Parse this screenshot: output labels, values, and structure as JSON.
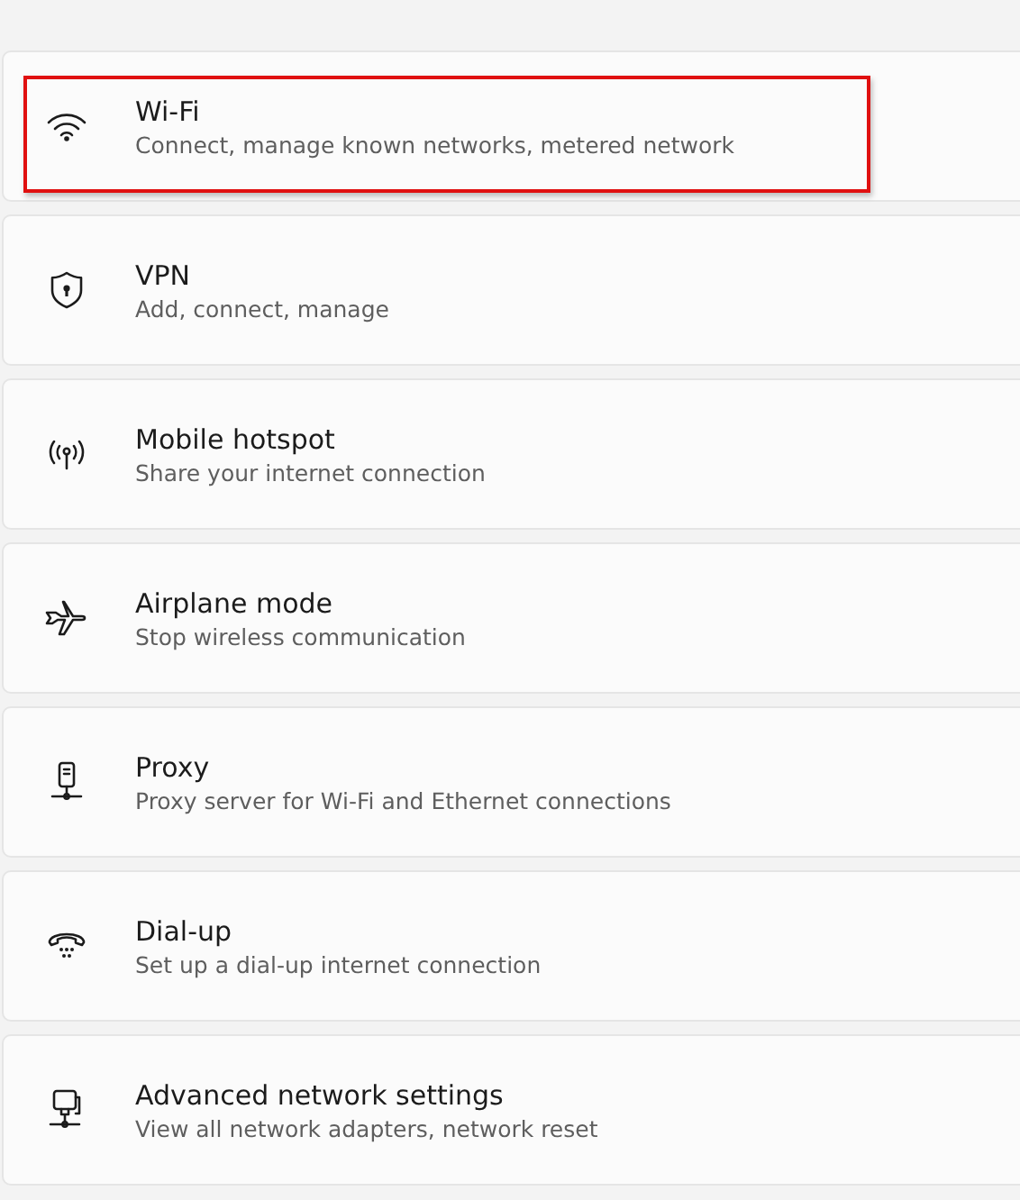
{
  "settings_items": [
    {
      "title": "Wi-Fi",
      "description": "Connect, manage known networks, metered network",
      "highlighted": true
    },
    {
      "title": "VPN",
      "description": "Add, connect, manage",
      "highlighted": false
    },
    {
      "title": "Mobile hotspot",
      "description": "Share your internet connection",
      "highlighted": false
    },
    {
      "title": "Airplane mode",
      "description": "Stop wireless communication",
      "highlighted": false
    },
    {
      "title": "Proxy",
      "description": "Proxy server for Wi-Fi and Ethernet connections",
      "highlighted": false
    },
    {
      "title": "Dial-up",
      "description": "Set up a dial-up internet connection",
      "highlighted": false
    },
    {
      "title": "Advanced network settings",
      "description": "View all network adapters, network reset",
      "highlighted": false
    }
  ]
}
